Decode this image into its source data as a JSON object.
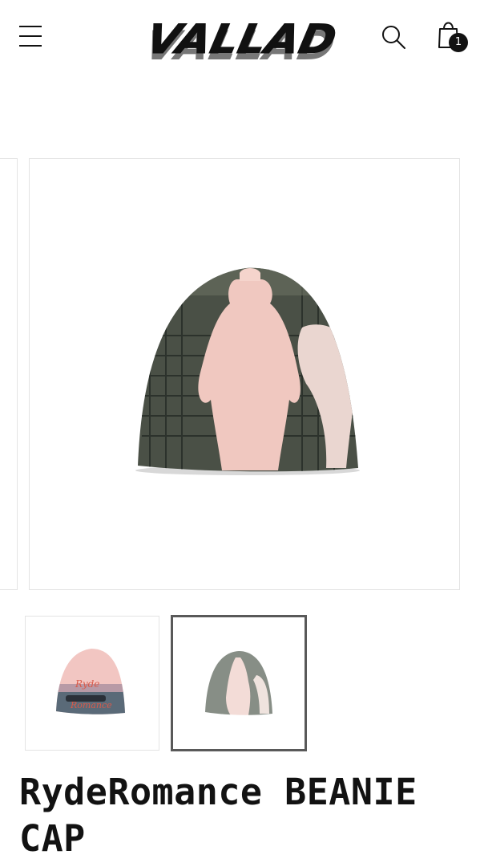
{
  "header": {
    "menu_icon": "hamburger-menu-icon",
    "logo_text": "VALLAD",
    "search_icon": "search-icon",
    "cart_icon": "shopping-bag-icon",
    "cart_count": "1"
  },
  "gallery": {
    "main_image": "beanie-cap-madonna-statue-print",
    "thumbnails": [
      {
        "image": "beanie-cap-ryde-romance-print",
        "selected": false
      },
      {
        "image": "beanie-cap-madonna-statue-print",
        "selected": true
      }
    ]
  },
  "product": {
    "title": "RydeRomance BEANIE CAP"
  },
  "colors": {
    "text": "#121212",
    "border": "#e4e4e4",
    "selected_border": "#595959",
    "badge_bg": "#121212"
  }
}
